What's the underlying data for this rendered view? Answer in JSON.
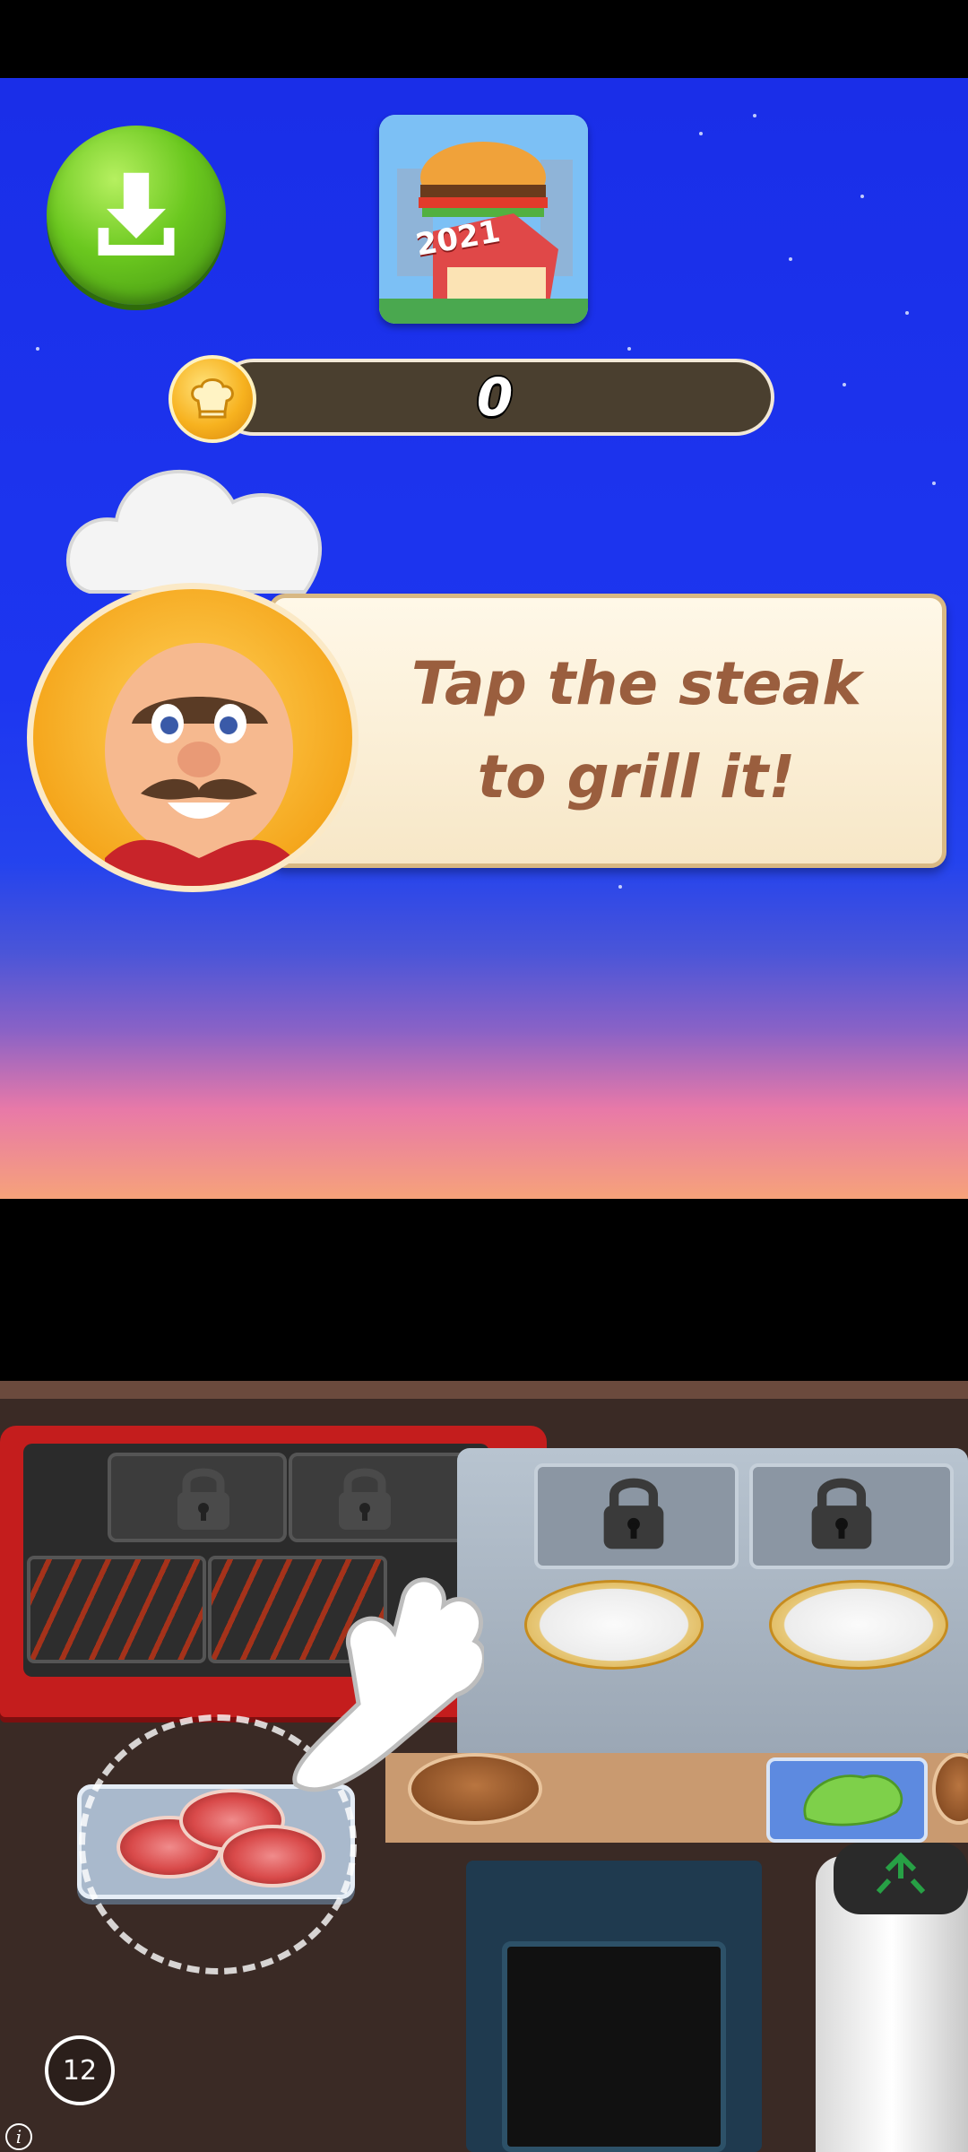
{
  "hud": {
    "coin_count": "0",
    "download_icon": "download-icon",
    "coin_icon": "chef-hat-coin-icon",
    "app_logo_text": "2021"
  },
  "tutorial": {
    "message": "Tap the steak\nto grill it!",
    "pointer_icon": "hand-pointer-icon"
  },
  "level_counter": "12",
  "info_icon": "i",
  "colors": {
    "sky": "#1d36f0",
    "speech_text": "#9a5e3e",
    "grill": "#c41d1d",
    "download_green": "#6bc81f",
    "coin_bar": "#4a3f2f"
  }
}
